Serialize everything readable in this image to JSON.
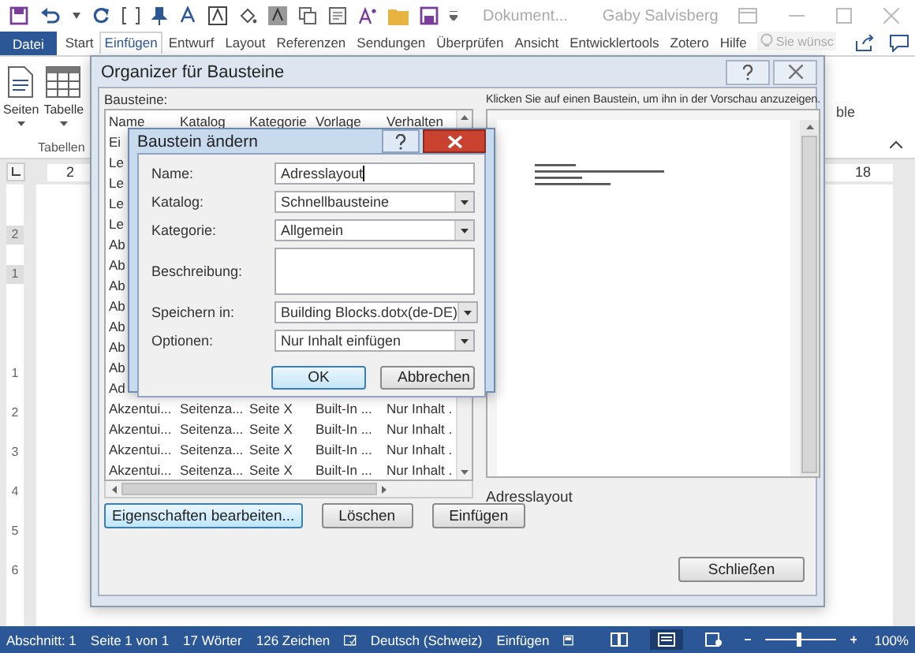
{
  "title_bar": {
    "document": "Dokument...",
    "user": "Gaby Salvisberg"
  },
  "ribbon_tabs": [
    {
      "label": "Datei",
      "kind": "file",
      "selected": false
    },
    {
      "label": "Start",
      "kind": "tab",
      "selected": false
    },
    {
      "label": "Einfügen",
      "kind": "tab",
      "selected": true
    },
    {
      "label": "Entwurf",
      "kind": "tab",
      "selected": false
    },
    {
      "label": "Layout",
      "kind": "tab",
      "selected": false
    },
    {
      "label": "Referenzen",
      "kind": "tab",
      "selected": false
    },
    {
      "label": "Sendungen",
      "kind": "tab",
      "selected": false
    },
    {
      "label": "Überprüfen",
      "kind": "tab",
      "selected": false
    },
    {
      "label": "Ansicht",
      "kind": "tab",
      "selected": false
    },
    {
      "label": "Entwicklertools",
      "kind": "tab",
      "selected": false
    },
    {
      "label": "Zotero",
      "kind": "tab",
      "selected": false
    },
    {
      "label": "Hilfe",
      "kind": "tab",
      "selected": false
    }
  ],
  "search": {
    "placeholder": "Sie wünsc"
  },
  "ribbon": {
    "buttons": [
      {
        "label": "Seiten",
        "kind": "pages"
      },
      {
        "label": "Tabelle",
        "kind": "table"
      }
    ],
    "group": "Tabellen",
    "right_label": "ble"
  },
  "ruler": {
    "top_marks": [
      "2",
      "18"
    ],
    "left_marks": [
      "2",
      "1",
      "1",
      "2",
      "3",
      "4",
      "5",
      "6"
    ]
  },
  "organizer": {
    "title": "Organizer für Bausteine",
    "list_label": "Bausteine:",
    "columns": [
      "Name",
      "Katalog",
      "Kategorie",
      "Vorlage",
      "Verhalten"
    ],
    "rows": [
      [
        "Ei"
      ],
      [
        "Le"
      ],
      [
        "Le"
      ],
      [
        "Le"
      ],
      [
        "Le"
      ],
      [
        "Ab"
      ],
      [
        "Ab"
      ],
      [
        "Ab"
      ],
      [
        "Ab"
      ],
      [
        "Ab"
      ],
      [
        "Ab"
      ],
      [
        "Ab"
      ],
      [
        "Ad"
      ],
      [
        "Akzentui...",
        "Seitenza...",
        "Seite X",
        "Built-In ...",
        "Nur Inhalt ."
      ],
      [
        "Akzentui...",
        "Seitenza...",
        "Seite X",
        "Built-In ...",
        "Nur Inhalt ."
      ],
      [
        "Akzentui...",
        "Seitenza...",
        "Seite X",
        "Built-In ...",
        "Nur Inhalt ."
      ],
      [
        "Akzentui...",
        "Seitenza...",
        "Seite X",
        "Built-In ...",
        "Nur Inhalt ."
      ]
    ],
    "buttons": [
      "Eigenschaften bearbeiten...",
      "Löschen",
      "Einfügen"
    ],
    "preview_hint": "Klicken Sie auf einen Baustein, um ihn in der Vorschau anzuzeigen.",
    "preview_name": "Adresslayout",
    "close_button": "Schließen"
  },
  "edit_dialog": {
    "title": "Baustein ändern",
    "fields": [
      {
        "label": "Name:",
        "kind": "text",
        "value": "Adresslayout"
      },
      {
        "label": "Katalog:",
        "kind": "dropdown",
        "value": "Schnellbausteine"
      },
      {
        "label": "Kategorie:",
        "kind": "dropdown",
        "value": "Allgemein"
      },
      {
        "label": "Beschreibung:",
        "kind": "textarea"
      },
      {
        "label": "Speichern in:",
        "kind": "dropdown",
        "value": "Building Blocks.dotx(de-DE)"
      },
      {
        "label": "Optionen:",
        "kind": "dropdown",
        "value": "Nur Inhalt einfügen"
      }
    ],
    "buttons": [
      {
        "label": "OK",
        "default": true
      },
      {
        "label": "Abbrechen",
        "default": false
      }
    ]
  },
  "status_bar": {
    "items": [
      "Abschnitt: 1",
      "Seite 1 von 1",
      "17 Wörter",
      "126 Zeichen"
    ],
    "language": "Deutsch (Schweiz)",
    "mode": "Einfügen",
    "views": [
      {
        "kind": "read",
        "selected": false
      },
      {
        "kind": "print",
        "selected": true
      },
      {
        "kind": "web",
        "selected": false
      }
    ],
    "zoom": {
      "level": 0.5,
      "reading": "100%"
    }
  }
}
